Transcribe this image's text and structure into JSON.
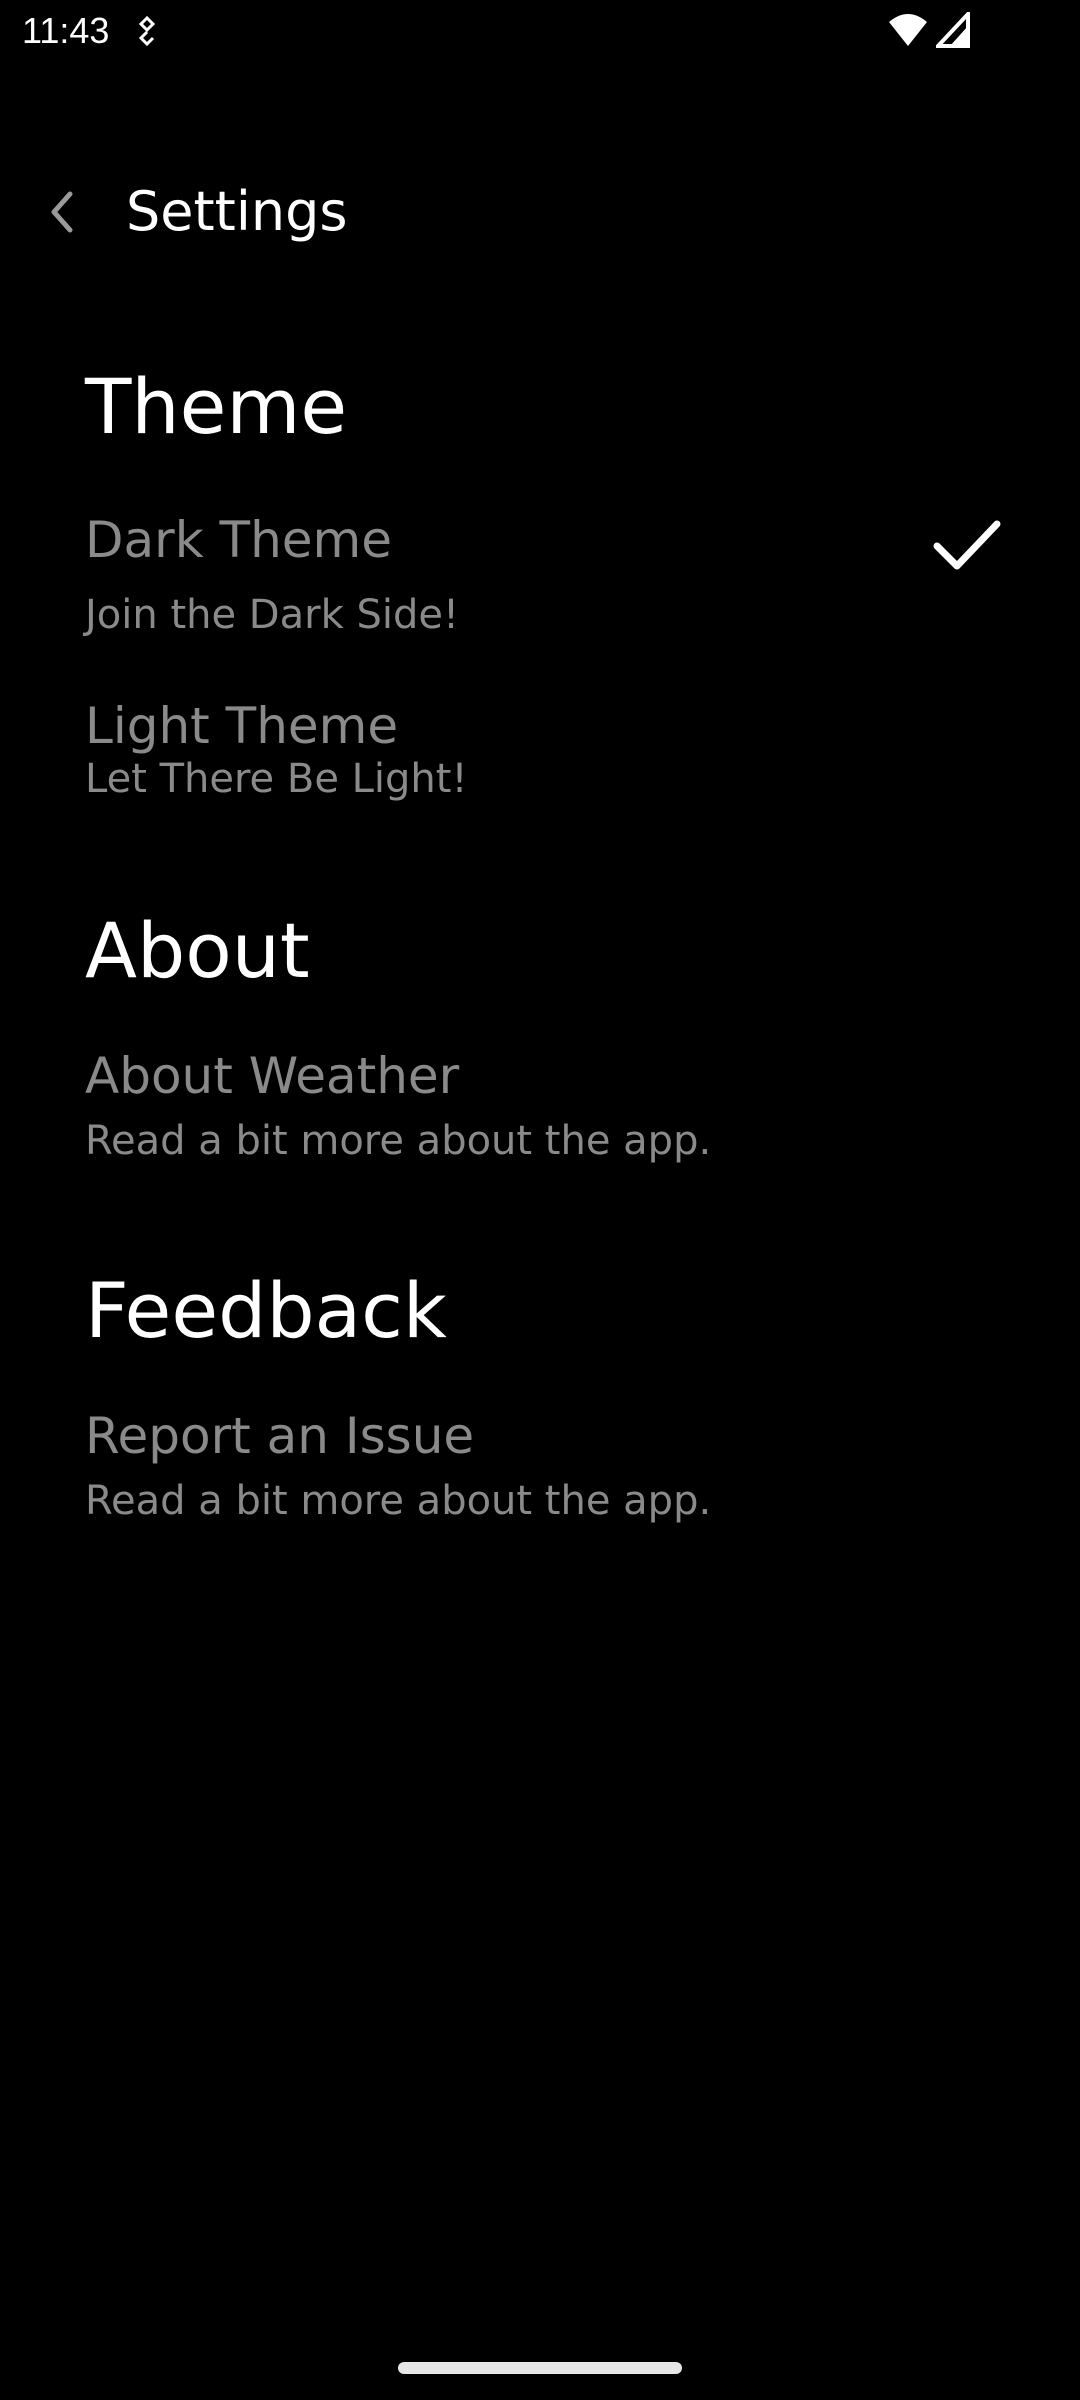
{
  "status_bar": {
    "time": "11:43",
    "icons": [
      "sync-icon",
      "wifi-icon",
      "signal-icon"
    ]
  },
  "header": {
    "title": "Settings",
    "back_icon": "chevron-left-icon"
  },
  "sections": {
    "theme": {
      "heading": "Theme",
      "items": [
        {
          "title": "Dark Theme",
          "subtitle": "Join the Dark Side!",
          "selected": true
        },
        {
          "title": "Light Theme",
          "subtitle": "Let There Be Light!",
          "selected": false
        }
      ]
    },
    "about": {
      "heading": "About",
      "items": [
        {
          "title": "About Weather",
          "subtitle": "Read a bit more about the app."
        }
      ]
    },
    "feedback": {
      "heading": "Feedback",
      "items": [
        {
          "title": "Report an Issue",
          "subtitle": "Read a bit more about the app."
        }
      ]
    }
  },
  "colors": {
    "background": "#000000",
    "heading": "#ffffff",
    "item_text": "#8a8a8a"
  }
}
